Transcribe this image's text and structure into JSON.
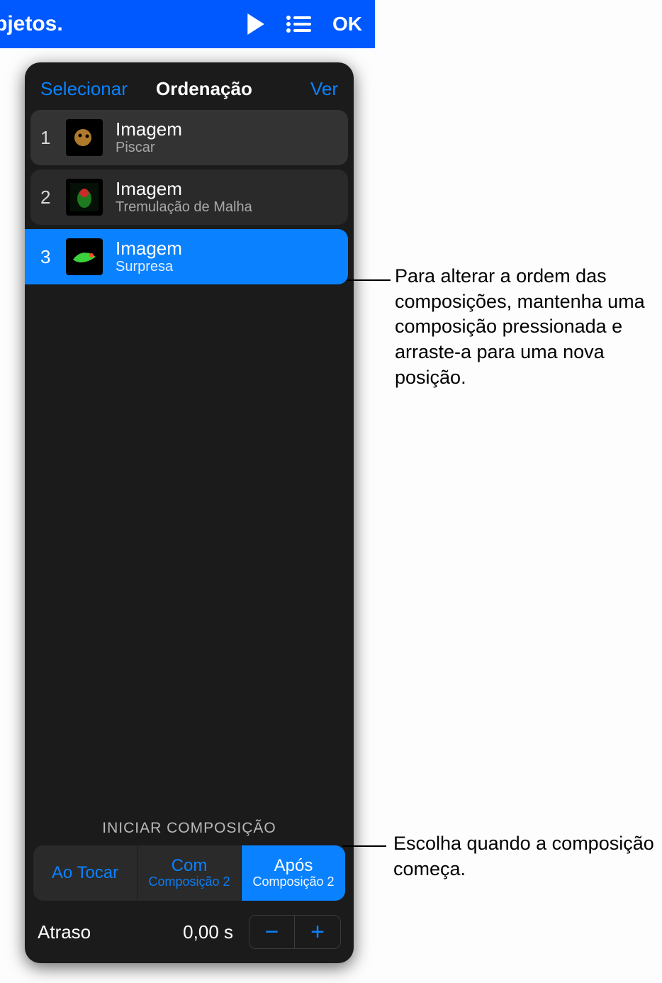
{
  "toolbar": {
    "title_fragment": "bjetos.",
    "ok_label": "OK"
  },
  "popover": {
    "select_label": "Selecionar",
    "title": "Ordenação",
    "view_label": "Ver",
    "builds": [
      {
        "index": "1",
        "name": "Imagem",
        "effect": "Piscar",
        "selected": false,
        "thumb": "leopard"
      },
      {
        "index": "2",
        "name": "Imagem",
        "effect": "Tremulação de Malha",
        "selected": false,
        "thumb": "parrot"
      },
      {
        "index": "3",
        "name": "Imagem",
        "effect": "Surpresa",
        "selected": true,
        "thumb": "chameleon"
      }
    ],
    "start_section_label": "INICIAR COMPOSIÇÃO",
    "segments": [
      {
        "label": "Ao Tocar",
        "sub": "",
        "active": false
      },
      {
        "label": "Com",
        "sub": "Composição 2",
        "active": false
      },
      {
        "label": "Após",
        "sub": "Composição 2",
        "active": true
      }
    ],
    "delay_label": "Atraso",
    "delay_value": "0,00  s"
  },
  "callouts": {
    "reorder": "Para alterar a ordem das composições, mantenha uma composição pressionada e arraste-a para uma nova posição.",
    "start": "Escolha quando a composição começa."
  }
}
